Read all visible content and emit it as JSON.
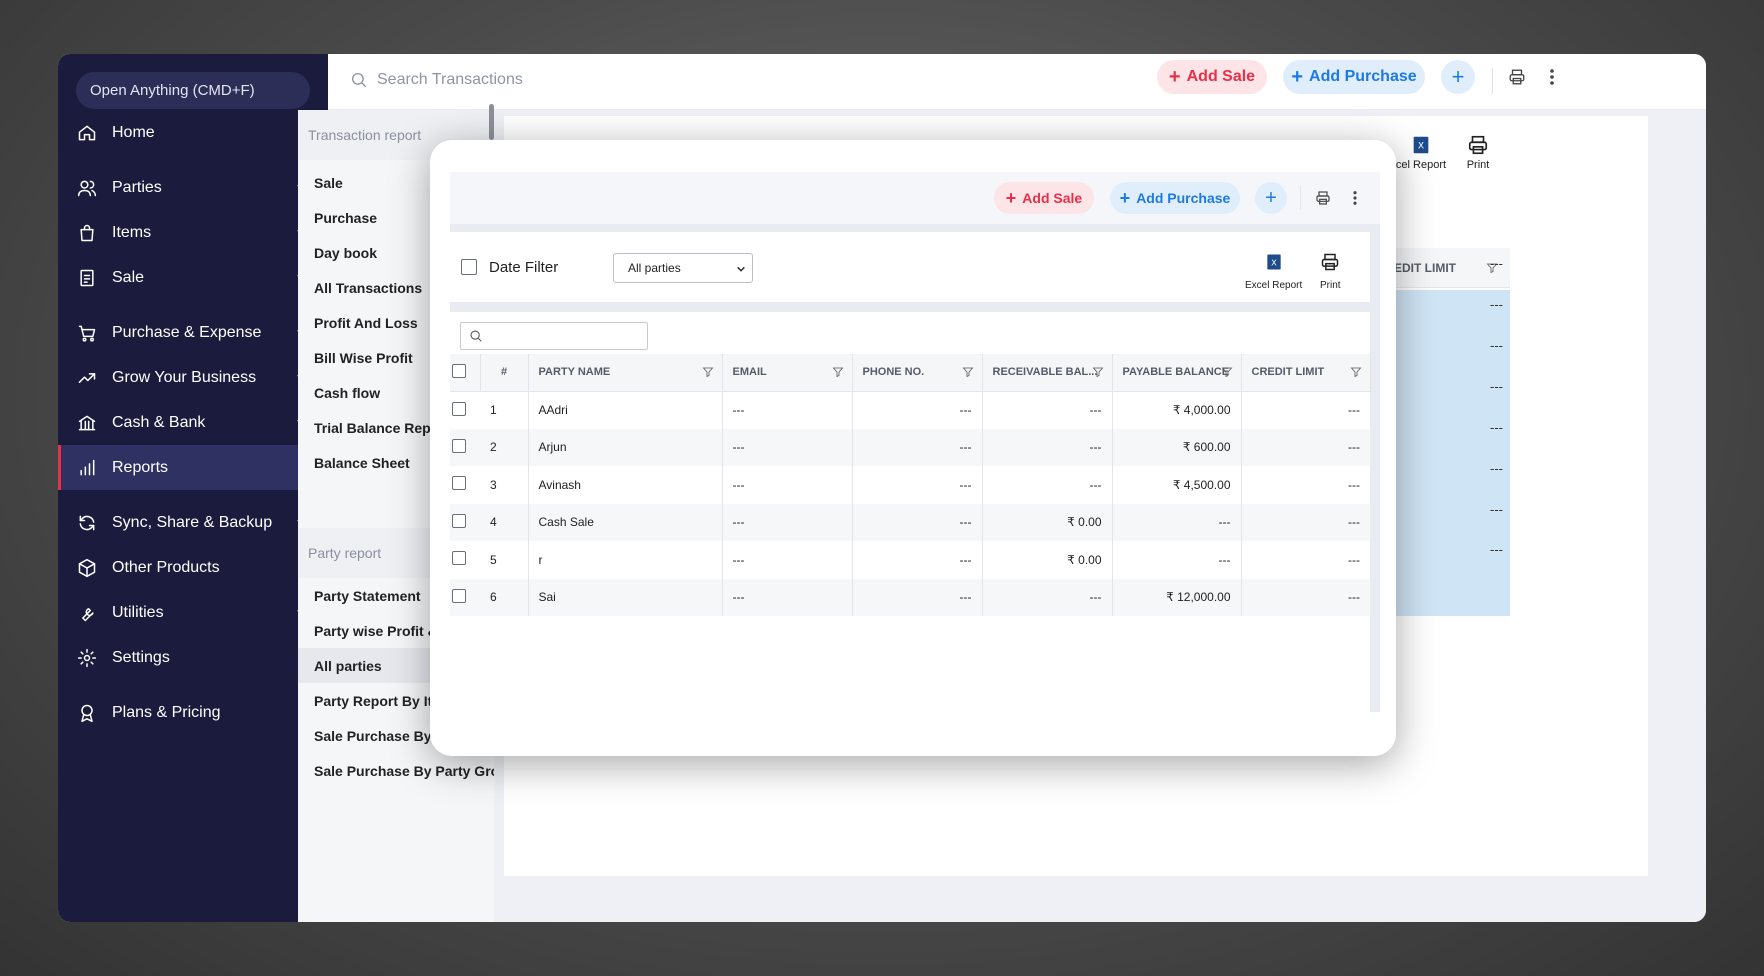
{
  "sidebar": {
    "search_label": "Open Anything (CMD+F)",
    "items": [
      {
        "label": "Home",
        "icon": "home-icon",
        "chevron": false
      },
      {
        "label": "Parties",
        "icon": "users-icon",
        "chevron": true
      },
      {
        "label": "Items",
        "icon": "bag-icon",
        "chevron": true
      },
      {
        "label": "Sale",
        "icon": "receipt-icon",
        "chevron": true
      },
      {
        "label": "Purchase & Expense",
        "icon": "cart-icon",
        "chevron": true
      },
      {
        "label": "Grow Your Business",
        "icon": "trend-icon",
        "chevron": true
      },
      {
        "label": "Cash & Bank",
        "icon": "bank-icon",
        "chevron": true
      },
      {
        "label": "Reports",
        "icon": "chart-icon",
        "chevron": false,
        "active": true
      },
      {
        "label": "Sync, Share & Backup",
        "icon": "sync-icon",
        "chevron": true
      },
      {
        "label": "Other Products",
        "icon": "box-icon",
        "chevron": false
      },
      {
        "label": "Utilities",
        "icon": "wrench-icon",
        "chevron": true
      },
      {
        "label": "Settings",
        "icon": "gear-icon",
        "chevron": false
      },
      {
        "label": "Plans & Pricing",
        "icon": "award-icon",
        "chevron": false
      }
    ]
  },
  "topbar": {
    "search_placeholder": "Search Transactions",
    "add_sale": "Add Sale",
    "add_purchase": "Add Purchase"
  },
  "report_menu": {
    "transaction_section": "Transaction report",
    "transaction_items": [
      "Sale",
      "Purchase",
      "Day book",
      "All Transactions",
      "Profit And Loss",
      "Bill Wise Profit",
      "Cash flow",
      "Trial Balance Report",
      "Balance Sheet"
    ],
    "party_section": "Party report",
    "party_items": [
      "Party Statement",
      "Party wise Profit & Loss",
      "All parties",
      "Party Report By Item",
      "Sale Purchase By Party",
      "Sale Purchase By Party Group"
    ]
  },
  "background": {
    "excel_label": "cel Report",
    "print_label": "Print",
    "credit_header": "EDIT LIMIT",
    "dash": "---"
  },
  "modal": {
    "add_sale": "Add Sale",
    "add_purchase": "Add Purchase",
    "date_filter": "Date Filter",
    "party_select": "All parties",
    "excel_report": "Excel Report",
    "print": "Print",
    "columns": [
      "#",
      "PARTY NAME",
      "EMAIL",
      "PHONE NO.",
      "RECEIVABLE BAL...",
      "PAYABLE BALANCE",
      "CREDIT LIMIT"
    ],
    "rows": [
      {
        "num": "1",
        "name": "AAdri",
        "email": "---",
        "phone": "---",
        "receivable": "---",
        "payable": "₹ 4,000.00",
        "credit": "---",
        "rec_type": "none",
        "pay_type": "neg"
      },
      {
        "num": "2",
        "name": "Arjun",
        "email": "---",
        "phone": "---",
        "receivable": "---",
        "payable": "₹ 600.00",
        "credit": "---",
        "rec_type": "none",
        "pay_type": "neg"
      },
      {
        "num": "3",
        "name": "Avinash",
        "email": "---",
        "phone": "---",
        "receivable": "---",
        "payable": "₹ 4,500.00",
        "credit": "---",
        "rec_type": "none",
        "pay_type": "neg"
      },
      {
        "num": "4",
        "name": "Cash Sale",
        "email": "---",
        "phone": "---",
        "receivable": "₹ 0.00",
        "payable": "---",
        "credit": "---",
        "rec_type": "pos",
        "pay_type": "none"
      },
      {
        "num": "5",
        "name": "r",
        "email": "---",
        "phone": "---",
        "receivable": "₹ 0.00",
        "payable": "---",
        "credit": "---",
        "rec_type": "pos",
        "pay_type": "none"
      },
      {
        "num": "6",
        "name": "Sai",
        "email": "---",
        "phone": "---",
        "receivable": "---",
        "payable": "₹ 12,000.00",
        "credit": "---",
        "rec_type": "none",
        "pay_type": "neg"
      }
    ]
  },
  "colors": {
    "accent_red": "#e8304a",
    "accent_blue": "#1e7ae0",
    "positive_green": "#1fae6a",
    "sidebar_bg": "#1b1c3d"
  }
}
